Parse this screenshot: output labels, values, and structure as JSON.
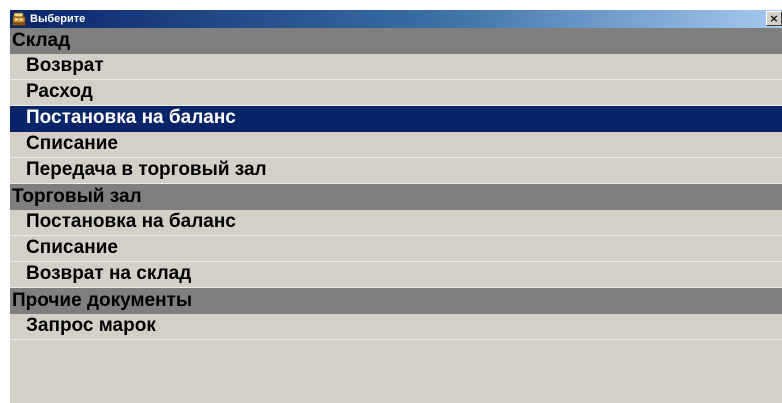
{
  "window": {
    "title": "Выберите",
    "close_glyph": "×",
    "icon": "cash-register-icon",
    "colors": {
      "titlebar_start": "#0a246a",
      "titlebar_end": "#a6caf0",
      "selection": "#0a246a",
      "group_header": "#7f7f7f",
      "background": "#d4d0c8"
    }
  },
  "groups": [
    {
      "title": "Склад",
      "items": [
        {
          "label": "Возврат",
          "selected": false
        },
        {
          "label": "Расход",
          "selected": false
        },
        {
          "label": "Постановка на баланс",
          "selected": true
        },
        {
          "label": "Списание",
          "selected": false
        },
        {
          "label": "Передача в торговый зал",
          "selected": false
        }
      ]
    },
    {
      "title": "Торговый зал",
      "items": [
        {
          "label": "Постановка на баланс",
          "selected": false
        },
        {
          "label": "Списание",
          "selected": false
        },
        {
          "label": "Возврат на склад",
          "selected": false
        }
      ]
    },
    {
      "title": "Прочие документы",
      "items": [
        {
          "label": "Запрос марок",
          "selected": false
        }
      ]
    }
  ]
}
